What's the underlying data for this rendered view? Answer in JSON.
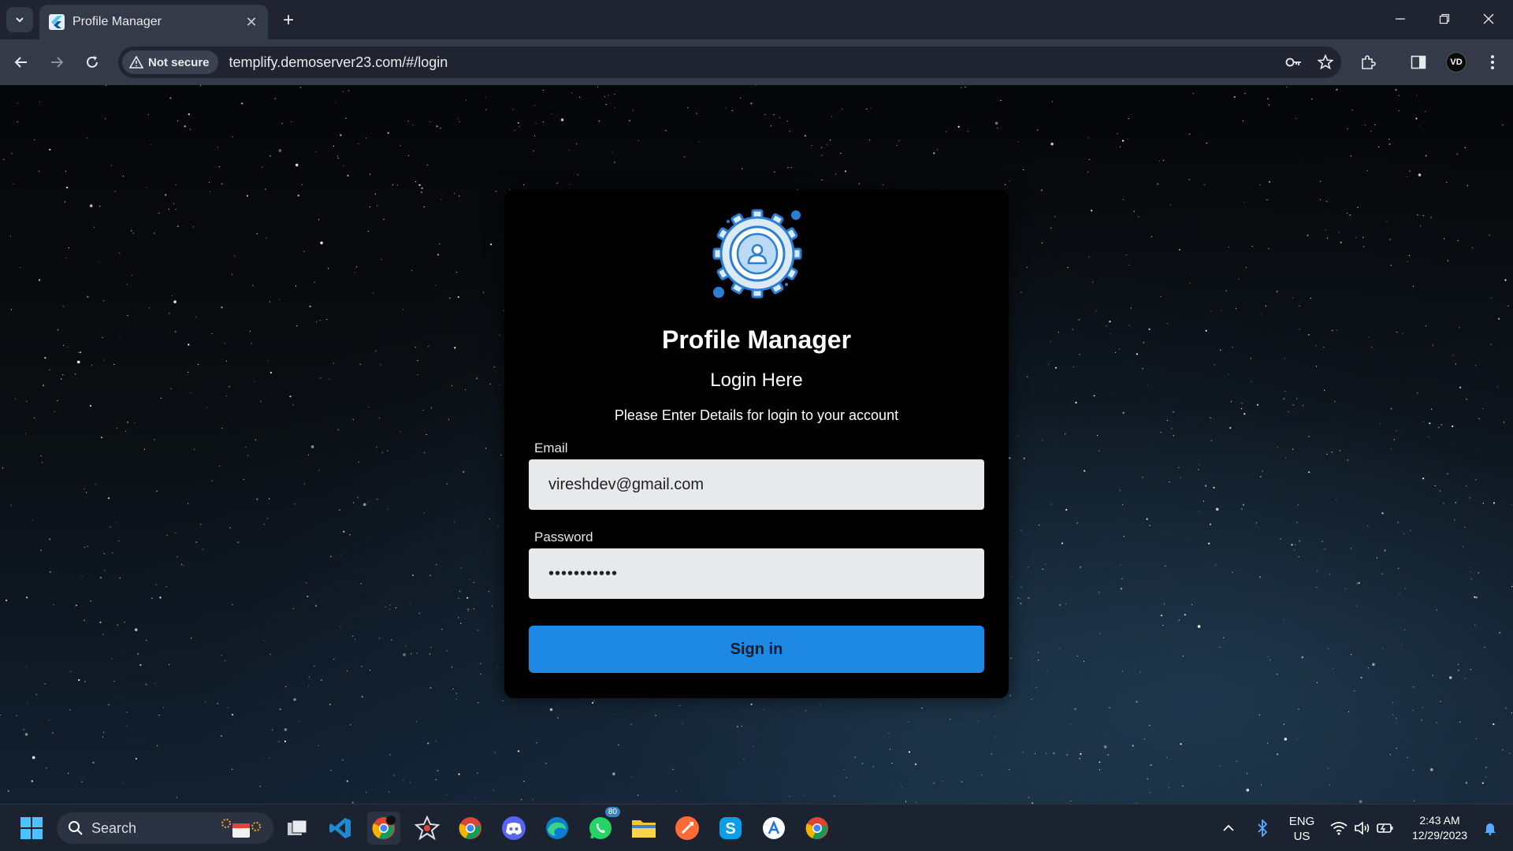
{
  "browser": {
    "tab": {
      "title": "Profile Manager",
      "favicon": "flutter-icon"
    },
    "security_label": "Not secure",
    "url": "templify.demoserver23.com/#/login",
    "profile_initials": "VD"
  },
  "page": {
    "app_title": "Profile Manager",
    "heading": "Login Here",
    "subtitle": "Please Enter Details for login to your account",
    "email": {
      "label": "Email",
      "value": "vireshdev@gmail.com"
    },
    "password": {
      "label": "Password",
      "value": "•••••••••••"
    },
    "signin_label": "Sign in",
    "logo": "user-gear-icon"
  },
  "taskbar": {
    "search_placeholder": "Search",
    "language": "ENG",
    "region": "US",
    "time": "2:43 AM",
    "date": "12/29/2023",
    "whatsapp_badge": "80",
    "apps": [
      "windows-start-icon",
      "task-view-icon",
      "vscode-icon",
      "chrome-profile-icon",
      "spider-app-icon",
      "chrome-icon",
      "discord-icon",
      "edge-icon",
      "whatsapp-icon",
      "file-explorer-icon",
      "postman-icon",
      "skype-icon",
      "app-store-icon",
      "chrome-alt-icon"
    ]
  },
  "colors": {
    "accent": "#1e88e5",
    "card": "#000000",
    "field": "#e8e9eb"
  }
}
